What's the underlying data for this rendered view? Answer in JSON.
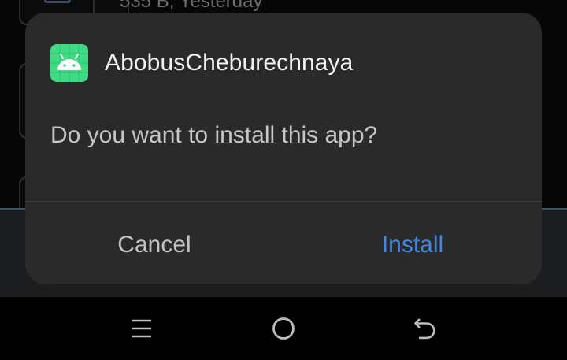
{
  "background": {
    "list_item_text": "535 B, Yesterday"
  },
  "dialog": {
    "app_name": "AbobusCheburechnaya",
    "app_icon": "android-robot-icon",
    "message": "Do you want to install this app?",
    "cancel_label": "Cancel",
    "install_label": "Install",
    "accent_color": "#3f86e6",
    "icon_color": "#3ddc84"
  },
  "navbar": {
    "items": [
      "recents-icon",
      "home-icon",
      "back-icon"
    ]
  }
}
